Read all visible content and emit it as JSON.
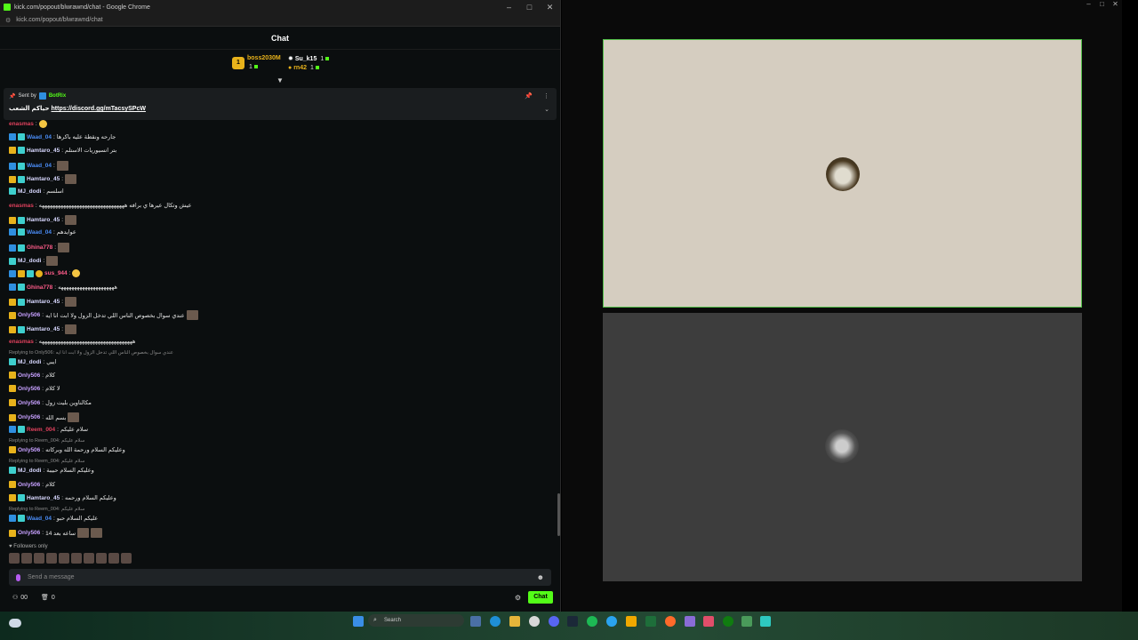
{
  "browser": {
    "window_title": "kick.com/popout/blwrawnd/chat - Google Chrome",
    "url": "kick.com/popout/blwrawnd/chat"
  },
  "chat": {
    "header": "Chat",
    "leaderboard": [
      {
        "name": "boss2030M",
        "count": "1",
        "color": "#e8b21b"
      },
      {
        "name": "Su_k15",
        "count": "1",
        "color": "#ffffff"
      },
      {
        "name": "rn42",
        "count": "1",
        "color": "#e8b21b"
      }
    ],
    "pinned": {
      "sent_by_label": "Sent by",
      "sender": "BotRix",
      "text_prefix": "حياكم الشعب",
      "link": "https://discord.gg/mTacsySPcW"
    },
    "messages": [
      {
        "user": "enasmas",
        "text": ""
      },
      {
        "user": "Waad_04",
        "text": "جارحه ونقطة عليه باكرها"
      },
      {
        "user": "Hamtaro_45",
        "text": "بتر انسيوريات الاستلم"
      },
      {
        "user": "Waad_04",
        "text": ""
      },
      {
        "user": "Hamtaro_45",
        "text": ""
      },
      {
        "user": "MJ_dodi",
        "text": "اسلسم"
      },
      {
        "user": "enasmas",
        "text": "عيش وتكال عيرها ي برافه ههههههههههههههههههههههههههههههههه"
      },
      {
        "user": "Hamtaro_45",
        "text": ""
      },
      {
        "user": "Waad_04",
        "text": "عوايدهم"
      },
      {
        "user": "Ghina778",
        "text": ""
      },
      {
        "user": "MJ_dodi",
        "text": ""
      },
      {
        "user": "sus_944",
        "text": ""
      },
      {
        "user": "Ghina778",
        "text": "هههههههههههههههههههههه"
      },
      {
        "user": "Hamtaro_45",
        "text": ""
      },
      {
        "user": "Only506",
        "text": "عندي سوال بخصوص الناس اللي تدخل الزول ولا ابت انا ايه"
      },
      {
        "user": "Hamtaro_45",
        "text": ""
      },
      {
        "user": "enasmas",
        "text": "هههههههههههههههههههههههههههههههههههه"
      },
      {
        "user": "MJ_dodi",
        "text": "ايبي"
      },
      {
        "user": "Only506",
        "text": "كلام"
      },
      {
        "user": "Only506",
        "text": "لا كلام"
      },
      {
        "user": "Only506",
        "text": "مكالناوين بليت زول"
      },
      {
        "user": "Only506",
        "text": "بسم الله"
      },
      {
        "user": "Reem_004",
        "text": "سلام عليكم"
      },
      {
        "user": "Only506",
        "text": "وعليكم السلام ورحمة الله وبركاته"
      },
      {
        "user": "MJ_dodi",
        "text": "وعليكم السلام حبيبة"
      },
      {
        "user": "Only506",
        "text": "كلام"
      },
      {
        "user": "Hamtaro_45",
        "text": "وعليكم السلام ورحمه"
      },
      {
        "user": "Waad_04",
        "text": "عليكم السلام حبو"
      },
      {
        "user": "Only506",
        "text": "14 ساعه بعد"
      }
    ],
    "replies": [
      "Replying to Only506: عندي سوال بخصوص الناس اللي تدخل الزول ولا ابت انا ايه",
      "Replying to Reem_004: سلام عليكم",
      "Replying to Reem_004: سلام عليكم",
      "Replying to Reem_004: سلام عليكم"
    ],
    "followers_only": "Followers only",
    "input_placeholder": "Send a message",
    "stats": {
      "users": "00",
      "gifts": "0"
    },
    "chat_button": "Chat"
  },
  "taskbar": {
    "search_placeholder": "Search"
  }
}
